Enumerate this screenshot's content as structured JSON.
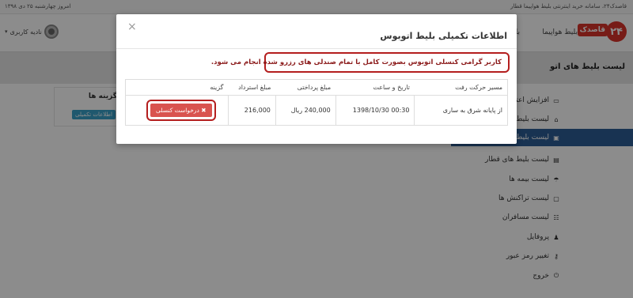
{
  "topbar": {
    "date": "امروز چهارشنبه ۲۵ دی ۱۳۹۸",
    "site": "قاصدک۲۴، سامانه خرید اینترنتی بلیط هواپیما قطار"
  },
  "navbar": {
    "logo_mark": "۲۴",
    "logo_text": "قاصدک",
    "links": [
      "بلیط هواپیما",
      "با"
    ],
    "user_name": "نادیه کاربری",
    "caret": "▾"
  },
  "page": {
    "title": "لیست بلیط های اتو"
  },
  "sidebar": {
    "items": [
      {
        "icon": "credit-card-icon",
        "glyph": "▭",
        "label": "افزایش اعتبار"
      },
      {
        "icon": "home-icon",
        "glyph": "⌂",
        "label": "لیست بلیط ها"
      },
      {
        "icon": "bus-icon",
        "glyph": "▣",
        "label": "لیست بلیط ها"
      },
      {
        "icon": "train-icon",
        "glyph": "▤",
        "label": "لیست بلیط های قطار"
      },
      {
        "icon": "umbrella-icon",
        "glyph": "☂",
        "label": "لیست بیمه ها"
      },
      {
        "icon": "money-icon",
        "glyph": "▢",
        "label": "لیست تراکنش ها"
      },
      {
        "icon": "users-icon",
        "glyph": "☷",
        "label": "لیست مسافران"
      },
      {
        "icon": "user-icon",
        "glyph": "♟",
        "label": "پروفایل"
      },
      {
        "icon": "key-icon",
        "glyph": "⚷",
        "label": "تغییر رمز عبور"
      },
      {
        "icon": "power-icon",
        "glyph": "⏻",
        "label": "خروج"
      }
    ]
  },
  "options_panel": {
    "header": "گزینه ها",
    "button": "اطلاعات تکمیلی"
  },
  "modal": {
    "close": "×",
    "title": "اطلاعات تکمیلی بلیط اتوبوس",
    "notice": "کاربر گرامی کنسلی اتوبوس بصورت کامل با تمام صندلی های رزرو شده انجام می شود.",
    "table": {
      "headers": [
        "مسیر حرکت رفت",
        "تاریخ و ساعت",
        "مبلغ پرداختی",
        "مبلغ استرداد",
        "گزینه"
      ],
      "row": {
        "route": "از پایانه شرق به ساری",
        "datetime": "1398/10/30 00:30",
        "paid": "240,000 ریال",
        "refund": "216,000",
        "action": "✖ درخواست کنسلی"
      }
    }
  },
  "colors": {
    "accent_blue": "#2d5e95",
    "danger_red": "#d9534f",
    "highlight_border": "#b41e1e",
    "info_button": "#3aa0c8"
  }
}
